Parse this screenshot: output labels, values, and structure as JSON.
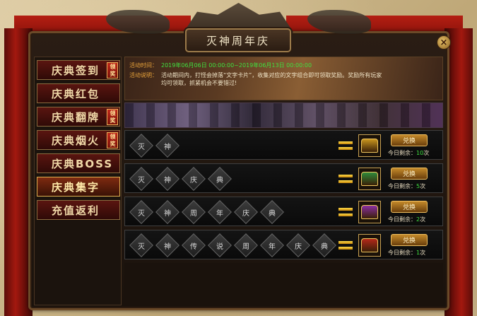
{
  "window": {
    "title": "灭神周年庆",
    "close_label": "×"
  },
  "sidebar": {
    "items": [
      {
        "label": "庆典签到",
        "badge": "领奖"
      },
      {
        "label": "庆典红包",
        "badge": ""
      },
      {
        "label": "庆典翻牌",
        "badge": "领奖"
      },
      {
        "label": "庆典烟火",
        "badge": "领奖"
      },
      {
        "label": "庆典BOSS",
        "badge": ""
      },
      {
        "label": "庆典集字",
        "badge": ""
      },
      {
        "label": "充值返利",
        "badge": ""
      }
    ],
    "active_index": 5
  },
  "info": {
    "time_label": "活动时间：",
    "time_value": "2019年06月06日 00:00:00~2019年06月13日 00:00:00",
    "desc_label": "活动说明：",
    "desc_value": "活动期间内，打怪会掉落“文字卡片”，收集对应的文字组合即可领取奖励。奖励所有玩家均可领取，抓紧机会不要错过!"
  },
  "rewards": [
    {
      "chars": [
        "灭",
        "神"
      ],
      "button": "兑换",
      "remain_prefix": "今日剩余：",
      "remain_count": "10",
      "remain_suffix": "次",
      "chest_color": "#c8941e"
    },
    {
      "chars": [
        "灭",
        "神",
        "庆",
        "典"
      ],
      "button": "兑换",
      "remain_prefix": "今日剩余：",
      "remain_count": "5",
      "remain_suffix": "次",
      "chest_color": "#2f8a3a"
    },
    {
      "chars": [
        "灭",
        "神",
        "周",
        "年",
        "庆",
        "典"
      ],
      "button": "兑换",
      "remain_prefix": "今日剩余：",
      "remain_count": "2",
      "remain_suffix": "次",
      "chest_color": "#8a2fa0"
    },
    {
      "chars": [
        "灭",
        "神",
        "传",
        "说",
        "周",
        "年",
        "庆",
        "典"
      ],
      "button": "兑换",
      "remain_prefix": "今日剩余：",
      "remain_count": "1",
      "remain_suffix": "次",
      "chest_color": "#b4281a"
    }
  ]
}
